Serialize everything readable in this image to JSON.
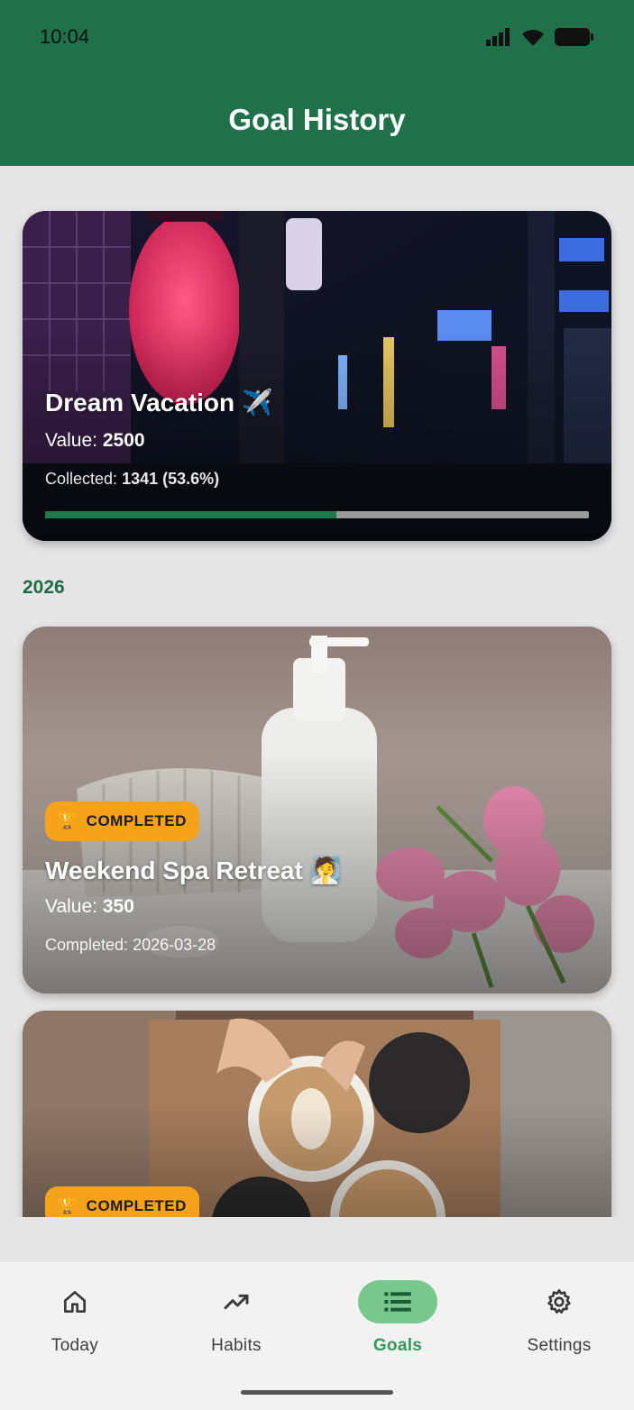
{
  "status_bar": {
    "time": "10:04"
  },
  "app_bar": {
    "title": "Goal History"
  },
  "current_goal": {
    "title": "Dream Vacation ✈️",
    "value_label": "Value:",
    "value": "2500",
    "collected_label": "Collected:",
    "collected": "1341 (53.6%)",
    "progress": 0.536
  },
  "history": {
    "year": "2026",
    "goals": [
      {
        "badge": "COMPLETED",
        "badge_icon": "trophy-icon",
        "title": "Weekend Spa Retreat 🧖",
        "value_label": "Value:",
        "value": "350",
        "completed_label": "Completed:",
        "completed_date": "2026-03-28"
      },
      {
        "badge": "COMPLETED",
        "badge_icon": "trophy-icon"
      }
    ]
  },
  "nav": {
    "items": [
      {
        "label": "Today",
        "icon": "home-icon"
      },
      {
        "label": "Habits",
        "icon": "trending-up-icon"
      },
      {
        "label": "Goals",
        "icon": "list-icon",
        "active": true
      },
      {
        "label": "Settings",
        "icon": "gear-icon"
      }
    ]
  },
  "colors": {
    "header": "#20704a",
    "progress": "#1f7a4b",
    "badge": "#f6a21a",
    "nav_active_pill": "#78c88e"
  }
}
